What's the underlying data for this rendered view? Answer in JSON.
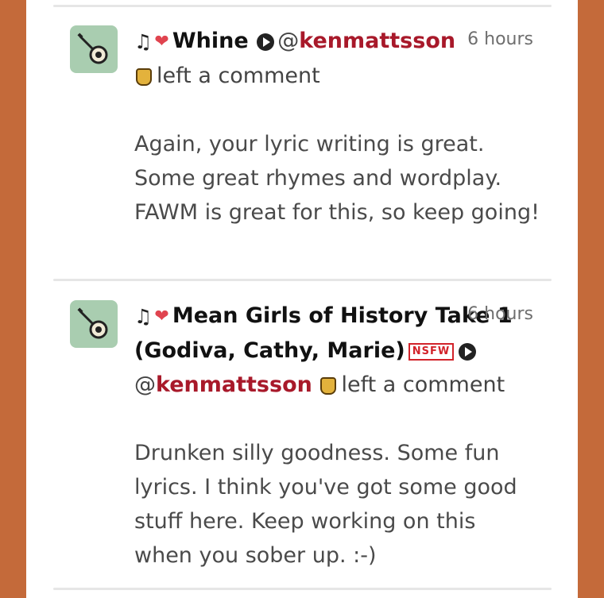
{
  "comments": [
    {
      "song_title": "Whine",
      "username": "kenmattsson",
      "at": "@",
      "time": "6 hours",
      "action": "left a comment",
      "text": "Again, your lyric writing is great. Some great rhymes and wordplay. FAWM is great for this, so keep going!",
      "nsfw": false
    },
    {
      "song_title": "Mean Girls of History Take 1 (Godiva, Cathy, Marie)",
      "username": "kenmattsson",
      "at": "@",
      "time": "6 hours",
      "action": "left a comment",
      "badge": "NSFW",
      "text": "Drunken silly goodness. Some fun lyrics. I think you've got some good stuff here. Keep working on this when you sober up. :-)",
      "nsfw": true
    }
  ],
  "icons": {
    "note": "music-note-icon",
    "heart": "heart-icon",
    "play": "play-icon",
    "rock": "rock-hand-icon",
    "avatar": "banjo-icon"
  },
  "colors": {
    "background": "#c46a3a",
    "username": "#a8192a",
    "avatar_bg": "#a9cdb0",
    "nsfw": "#d2232a"
  }
}
